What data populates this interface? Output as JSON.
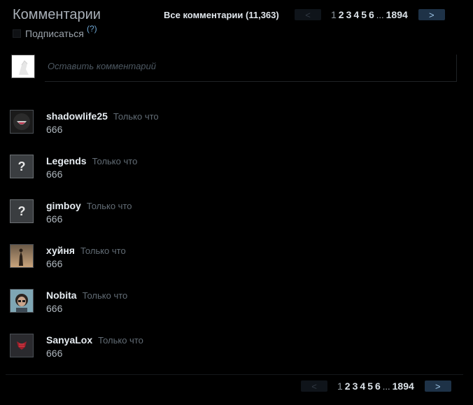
{
  "header": {
    "title": "Комментарии",
    "subscribe_label": "Подписаться",
    "help": "(?)",
    "all_comments": "Все комментарии (11,363)"
  },
  "pagination": {
    "prev": "<",
    "next": ">",
    "pages": [
      "1",
      "2",
      "3",
      "4",
      "5",
      "6"
    ],
    "current": "1",
    "ellipsis": "...",
    "last": "1894"
  },
  "composer": {
    "placeholder": "Оставить комментарий"
  },
  "comments": [
    {
      "author": "shadowlife25",
      "time": "Только что",
      "text": "666",
      "avatar": "smile-avatar"
    },
    {
      "author": "Legends",
      "time": "Только что",
      "text": "666",
      "avatar": "unknown-avatar"
    },
    {
      "author": "gimboy",
      "time": "Только что",
      "text": "666",
      "avatar": "unknown-avatar"
    },
    {
      "author": "хуйня",
      "time": "Только что",
      "text": "666",
      "avatar": "sepia-figure-avatar"
    },
    {
      "author": "Nobita",
      "time": "Только что",
      "text": "666",
      "avatar": "portrait-avatar"
    },
    {
      "author": "SanyaLox",
      "time": "Только что",
      "text": "666",
      "avatar": "red-emblem-avatar"
    }
  ],
  "colors": {
    "background": "#000000",
    "accent_link": "#6da5d1",
    "next_button": "#1e3247",
    "timestamp": "#626c75"
  }
}
